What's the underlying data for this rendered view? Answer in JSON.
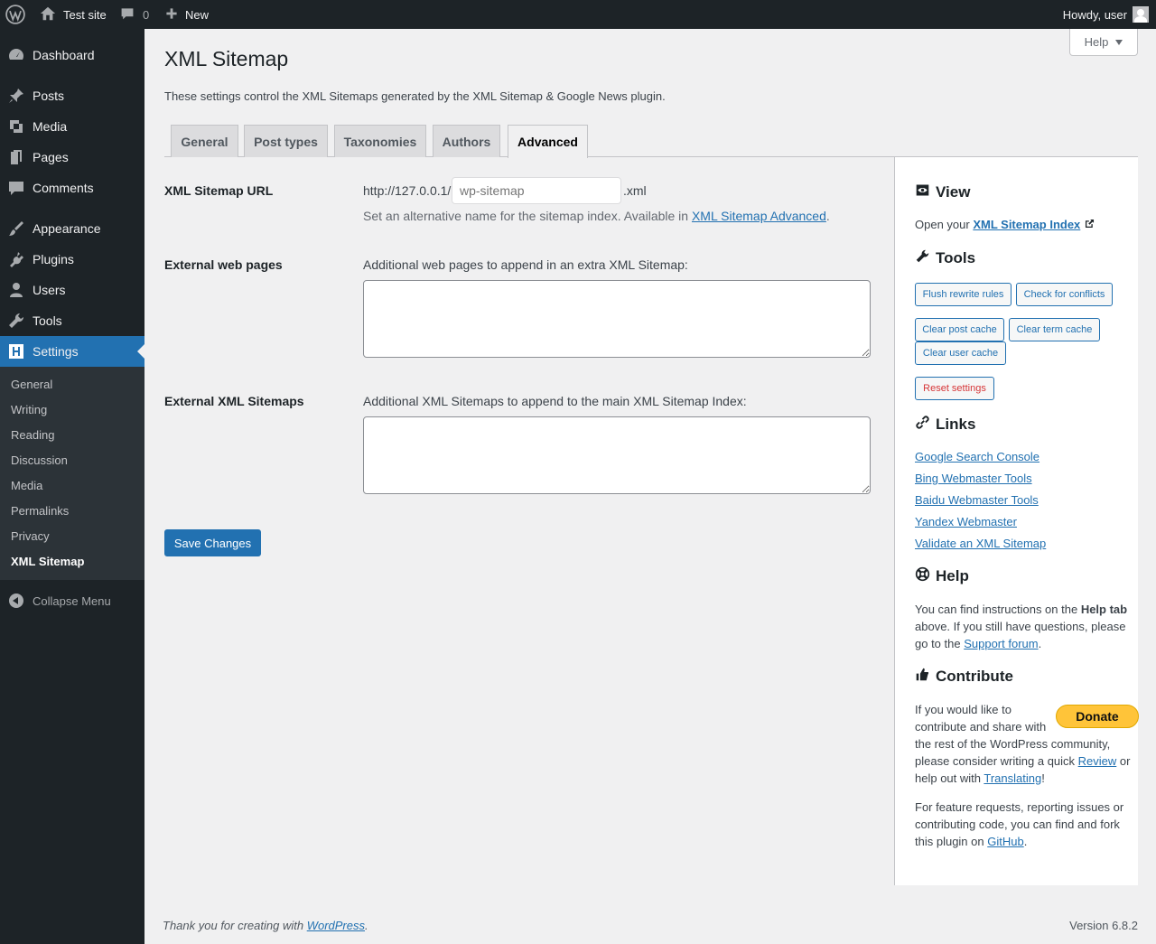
{
  "adminbar": {
    "site_name": "Test site",
    "comments_count": "0",
    "new_label": "New",
    "howdy": "Howdy, user"
  },
  "sidebar": {
    "items": [
      {
        "label": "Dashboard",
        "icon": "dashboard-icon"
      },
      {
        "label": "Posts",
        "icon": "pin-icon"
      },
      {
        "label": "Media",
        "icon": "media-icon"
      },
      {
        "label": "Pages",
        "icon": "pages-icon"
      },
      {
        "label": "Comments",
        "icon": "comment-icon"
      },
      {
        "label": "Appearance",
        "icon": "brush-icon"
      },
      {
        "label": "Plugins",
        "icon": "plug-icon"
      },
      {
        "label": "Users",
        "icon": "user-icon"
      },
      {
        "label": "Tools",
        "icon": "wrench-icon"
      },
      {
        "label": "Settings",
        "icon": "settings-icon"
      }
    ],
    "submenu": [
      "General",
      "Writing",
      "Reading",
      "Discussion",
      "Media",
      "Permalinks",
      "Privacy",
      "XML Sitemap"
    ],
    "collapse_label": "Collapse Menu"
  },
  "help_label": "Help",
  "page": {
    "title": "XML Sitemap",
    "intro": "These settings control the XML Sitemaps generated by the XML Sitemap & Google News plugin.",
    "tabs": [
      "General",
      "Post types",
      "Taxonomies",
      "Authors",
      "Advanced"
    ],
    "active_tab": "Advanced"
  },
  "form": {
    "url_label": "XML Sitemap URL",
    "url_prefix": "http://127.0.0.1/",
    "url_placeholder": "wp-sitemap",
    "url_suffix": ".xml",
    "url_desc": "Set an alternative name for the sitemap index. Available in ",
    "url_desc_link": "XML Sitemap Advanced",
    "url_desc_end": ".",
    "ext_pages_label": "External web pages",
    "ext_pages_desc": "Additional web pages to append in an extra XML Sitemap:",
    "ext_sitemaps_label": "External XML Sitemaps",
    "ext_sitemaps_desc": "Additional XML Sitemaps to append to the main XML Sitemap Index:",
    "save_label": "Save Changes"
  },
  "panel": {
    "view_title": "View",
    "view_text": "Open your ",
    "view_link": "XML Sitemap Index",
    "tools_title": "Tools",
    "tools_buttons": [
      "Flush rewrite rules",
      "Check for conflicts",
      "Clear post cache",
      "Clear term cache",
      "Clear user cache",
      "Reset settings"
    ],
    "links_title": "Links",
    "links": [
      "Google Search Console",
      "Bing Webmaster Tools",
      "Baidu Webmaster Tools",
      "Yandex Webmaster",
      "Validate an XML Sitemap"
    ],
    "help_title": "Help",
    "help_text_1": "You can find instructions on the ",
    "help_text_bold": "Help tab",
    "help_text_2": " above. If you still have questions, please go to the ",
    "help_link": "Support forum",
    "help_text_end": ".",
    "contribute_title": "Contribute",
    "donate_label": "Donate",
    "contribute_text_1": "If you would like to contribute and share with the rest of the WordPress community, please consider writing a quick ",
    "review_link": "Review",
    "contribute_text_2": " or help out with ",
    "translating_link": "Translating",
    "contribute_text_end": "!",
    "feature_text": "For feature requests, reporting issues or contributing code, you can find and fork this plugin on ",
    "github_link": "GitHub",
    "feature_end": "."
  },
  "footer": {
    "thanks": "Thank you for creating with ",
    "wp_link": "WordPress",
    "thanks_end": ".",
    "version": "Version 6.8.2"
  },
  "colors": {
    "accent": "#2271b1",
    "adminbar_bg": "#1d2327",
    "danger": "#d63638",
    "donate": "#ffc439"
  }
}
